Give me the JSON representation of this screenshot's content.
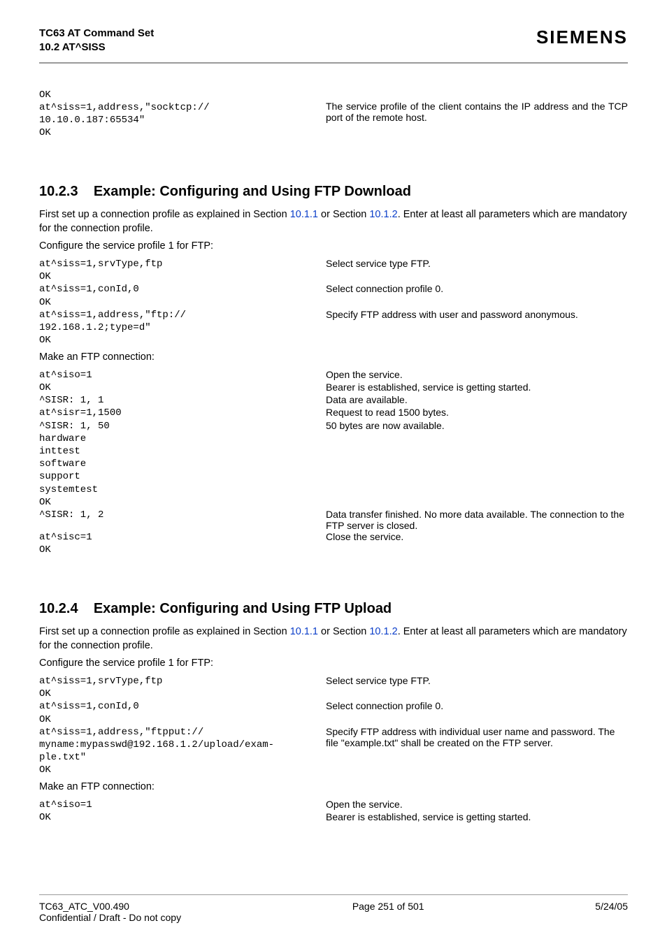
{
  "header": {
    "title_line1": "TC63 AT Command Set",
    "title_line2": "10.2 AT^SISS",
    "logo": "SIEMENS"
  },
  "intro_block": {
    "left": "OK\nat^siss=1,address,\"socktcp://\n10.10.0.187:65534\"\nOK",
    "right": "The service profile of the client contains the IP address and the TCP port of the remote host."
  },
  "section_1023": {
    "number": "10.2.3",
    "title": "Example: Configuring and Using FTP Download",
    "para1_pre": "First set up a connection profile as explained in Section ",
    "link1": "10.1.1",
    "para1_mid": " or Section ",
    "link2": "10.1.2",
    "para1_post": ". Enter at least all parameters which are mandatory for the connection profile.",
    "para2": "Configure the service profile 1 for FTP:",
    "rows1": [
      {
        "l": "at^siss=1,srvType,ftp",
        "r": "Select service type FTP."
      },
      {
        "l": "OK",
        "r": ""
      },
      {
        "l": "at^siss=1,conId,0",
        "r": "Select connection profile 0."
      },
      {
        "l": "OK",
        "r": ""
      },
      {
        "l": "at^siss=1,address,\"ftp://\n192.168.1.2;type=d\"",
        "r": "Specify FTP address with user and password anonymous."
      },
      {
        "l": "OK",
        "r": ""
      }
    ],
    "para3": "Make an FTP connection:",
    "rows2": [
      {
        "l": "at^siso=1",
        "r": "Open the service."
      },
      {
        "l": "OK",
        "r": "Bearer is established, service is getting started."
      },
      {
        "l": "^SISR: 1, 1",
        "r": "Data are available."
      },
      {
        "l": "at^sisr=1,1500",
        "r": "Request to read 1500 bytes."
      },
      {
        "l": "^SISR: 1, 50",
        "r": "50 bytes are now available."
      },
      {
        "l": "hardware",
        "r": ""
      },
      {
        "l": "inttest",
        "r": ""
      },
      {
        "l": "software",
        "r": ""
      },
      {
        "l": "support",
        "r": ""
      },
      {
        "l": "systemtest",
        "r": ""
      },
      {
        "l": "OK",
        "r": ""
      },
      {
        "l": "^SISR: 1, 2",
        "r": "Data transfer finished. No more data available. The connection to the FTP server is closed."
      },
      {
        "l": "at^sisc=1",
        "r": "Close the service."
      },
      {
        "l": "OK",
        "r": ""
      }
    ]
  },
  "section_1024": {
    "number": "10.2.4",
    "title": "Example: Configuring and Using FTP Upload",
    "para1_pre": "First set up a connection profile as explained in Section ",
    "link1": "10.1.1",
    "para1_mid": " or Section ",
    "link2": "10.1.2",
    "para1_post": ". Enter at least all parameters which are mandatory for the connection profile.",
    "para2": "Configure the service profile 1 for FTP:",
    "rows1": [
      {
        "l": "at^siss=1,srvType,ftp",
        "r": "Select service type FTP."
      },
      {
        "l": "OK",
        "r": ""
      },
      {
        "l": "at^siss=1,conId,0",
        "r": "Select connection profile 0."
      },
      {
        "l": "OK",
        "r": ""
      },
      {
        "l": "at^siss=1,address,\"ftpput://\nmyname:mypasswd@192.168.1.2/upload/exam-\nple.txt\"",
        "r": "Specify FTP address with individual user name and password. The file \"example.txt\" shall be created on the FTP server."
      },
      {
        "l": "OK",
        "r": ""
      }
    ],
    "para3": "Make an FTP connection:",
    "rows2": [
      {
        "l": "at^siso=1",
        "r": "Open the service."
      },
      {
        "l": "OK",
        "r": "Bearer is established, service is getting started."
      }
    ]
  },
  "footer": {
    "left_line1": "TC63_ATC_V00.490",
    "left_line2": "Confidential / Draft - Do not copy",
    "center": "Page 251 of 501",
    "right": "5/24/05"
  }
}
